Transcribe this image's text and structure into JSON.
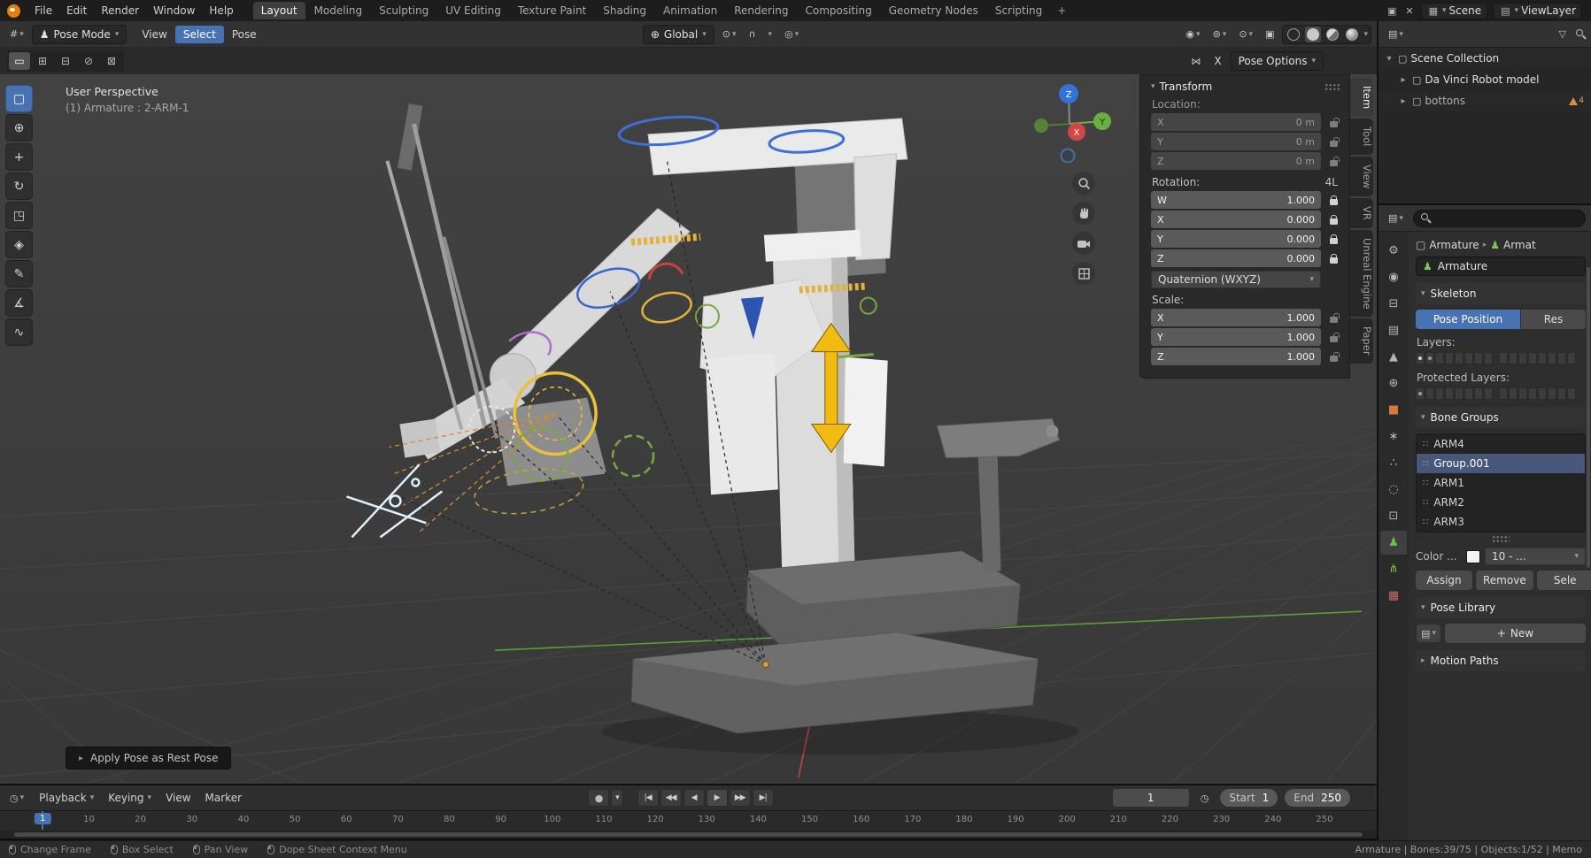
{
  "topbar": {
    "menus": [
      "File",
      "Edit",
      "Render",
      "Window",
      "Help"
    ],
    "workspaces": [
      "Layout",
      "Modeling",
      "Sculpting",
      "UV Editing",
      "Texture Paint",
      "Shading",
      "Animation",
      "Rendering",
      "Compositing",
      "Geometry Nodes",
      "Scripting"
    ],
    "active_workspace": "Layout",
    "add_workspace": "+",
    "scene_label": "Scene",
    "view_layer_label": "ViewLayer"
  },
  "viewport": {
    "header": {
      "mode": "Pose Mode",
      "menus": [
        "View",
        "Select",
        "Pose"
      ],
      "active_menu": "Select",
      "orientation": "Global"
    },
    "tool_settings": {
      "select_modes": [
        "set",
        "extend",
        "subtract",
        "invert",
        "intersect"
      ],
      "active_select_mode": "set",
      "mirror_x_label": "X",
      "pose_options_label": "Pose Options"
    },
    "tools": {
      "items": [
        "select-box",
        "cursor",
        "move",
        "rotate",
        "scale",
        "transform",
        "annotate",
        "measure",
        "pose-breakdowner"
      ],
      "active": "select-box"
    },
    "overlay": {
      "perspective": "User Perspective",
      "active_object": "(1) Armature : 2-ARM-1"
    },
    "axis_gizmo": {
      "x": "X",
      "y": "Y",
      "z": "Z"
    },
    "toast": "Apply Pose as Rest Pose"
  },
  "sidebar": {
    "tabs": [
      "Item",
      "Tool",
      "View",
      "VR",
      "Unreal Engine",
      "Paper"
    ],
    "active_tab": "Item",
    "transform": {
      "title": "Transform",
      "location_label": "Location:",
      "location": [
        {
          "axis": "X",
          "value": "0 m"
        },
        {
          "axis": "Y",
          "value": "0 m"
        },
        {
          "axis": "Z",
          "value": "0 m"
        }
      ],
      "rotation_label": "Rotation:",
      "rotation_mode_hint": "4L",
      "rotation": [
        {
          "axis": "W",
          "value": "1.000"
        },
        {
          "axis": "X",
          "value": "0.000"
        },
        {
          "axis": "Y",
          "value": "0.000"
        },
        {
          "axis": "Z",
          "value": "0.000"
        }
      ],
      "rotation_mode": "Quaternion (WXYZ)",
      "scale_label": "Scale:",
      "scale": [
        {
          "axis": "X",
          "value": "1.000"
        },
        {
          "axis": "Y",
          "value": "1.000"
        },
        {
          "axis": "Z",
          "value": "1.000"
        }
      ]
    }
  },
  "outliner": {
    "items": [
      {
        "label": "Scene Collection",
        "depth": 0,
        "expanded": true,
        "dim": false,
        "badge": ""
      },
      {
        "label": "Da Vinci Robot model",
        "depth": 1,
        "expanded": false,
        "dim": false,
        "badge": ""
      },
      {
        "label": "bottons",
        "depth": 1,
        "expanded": false,
        "dim": true,
        "badge": "4"
      }
    ]
  },
  "properties": {
    "tabs": [
      "tool",
      "render",
      "output",
      "view-layer",
      "scene",
      "world",
      "object",
      "modifiers",
      "particles",
      "physics",
      "constraints",
      "object-data",
      "bone",
      "texture"
    ],
    "active_tab": "object-data",
    "breadcrumb": {
      "object": "Armature",
      "data": "Armat"
    },
    "name_field": "Armature",
    "skeleton": {
      "title": "Skeleton",
      "pose_position_label": "Pose Position",
      "rest_position_label": "Res",
      "layers_label": "Layers:",
      "protected_layers_label": "Protected Layers:",
      "layers": {
        "used": [
          0,
          1
        ],
        "active": [
          0
        ]
      },
      "protected_layers": {
        "used": [
          0
        ],
        "active": []
      }
    },
    "bone_groups": {
      "title": "Bone Groups",
      "items": [
        "ARM4",
        "Group.001",
        "ARM1",
        "ARM2",
        "ARM3"
      ],
      "selected": "Group.001",
      "color_label": "Color ...",
      "color_set_value": "10 - ...",
      "assign_label": "Assign",
      "remove_label": "Remove",
      "select_label": "Sele"
    },
    "pose_library": {
      "title": "Pose Library",
      "new_label": "New"
    },
    "motion_paths": {
      "title": "Motion Paths"
    }
  },
  "timeline": {
    "menus": [
      "Playback",
      "Keying",
      "View",
      "Marker"
    ],
    "transport": [
      "jump-start",
      "prev-keyframe",
      "play-reverse",
      "play",
      "next-keyframe",
      "jump-end"
    ],
    "current_frame": "1",
    "start_label": "Start",
    "start_value": "1",
    "end_label": "End",
    "end_value": "250",
    "ticks": [
      "1",
      "10",
      "20",
      "30",
      "40",
      "50",
      "60",
      "70",
      "80",
      "90",
      "100",
      "110",
      "120",
      "130",
      "140",
      "150",
      "160",
      "170",
      "180",
      "190",
      "200",
      "210",
      "220",
      "230",
      "240",
      "250"
    ]
  },
  "statusbar": {
    "hints": [
      "Change Frame",
      "Box Select",
      "Pan View",
      "Dope Sheet Context Menu"
    ],
    "stats": "Armature | Bones:39/75 | Objects:1/52 | Memo"
  }
}
